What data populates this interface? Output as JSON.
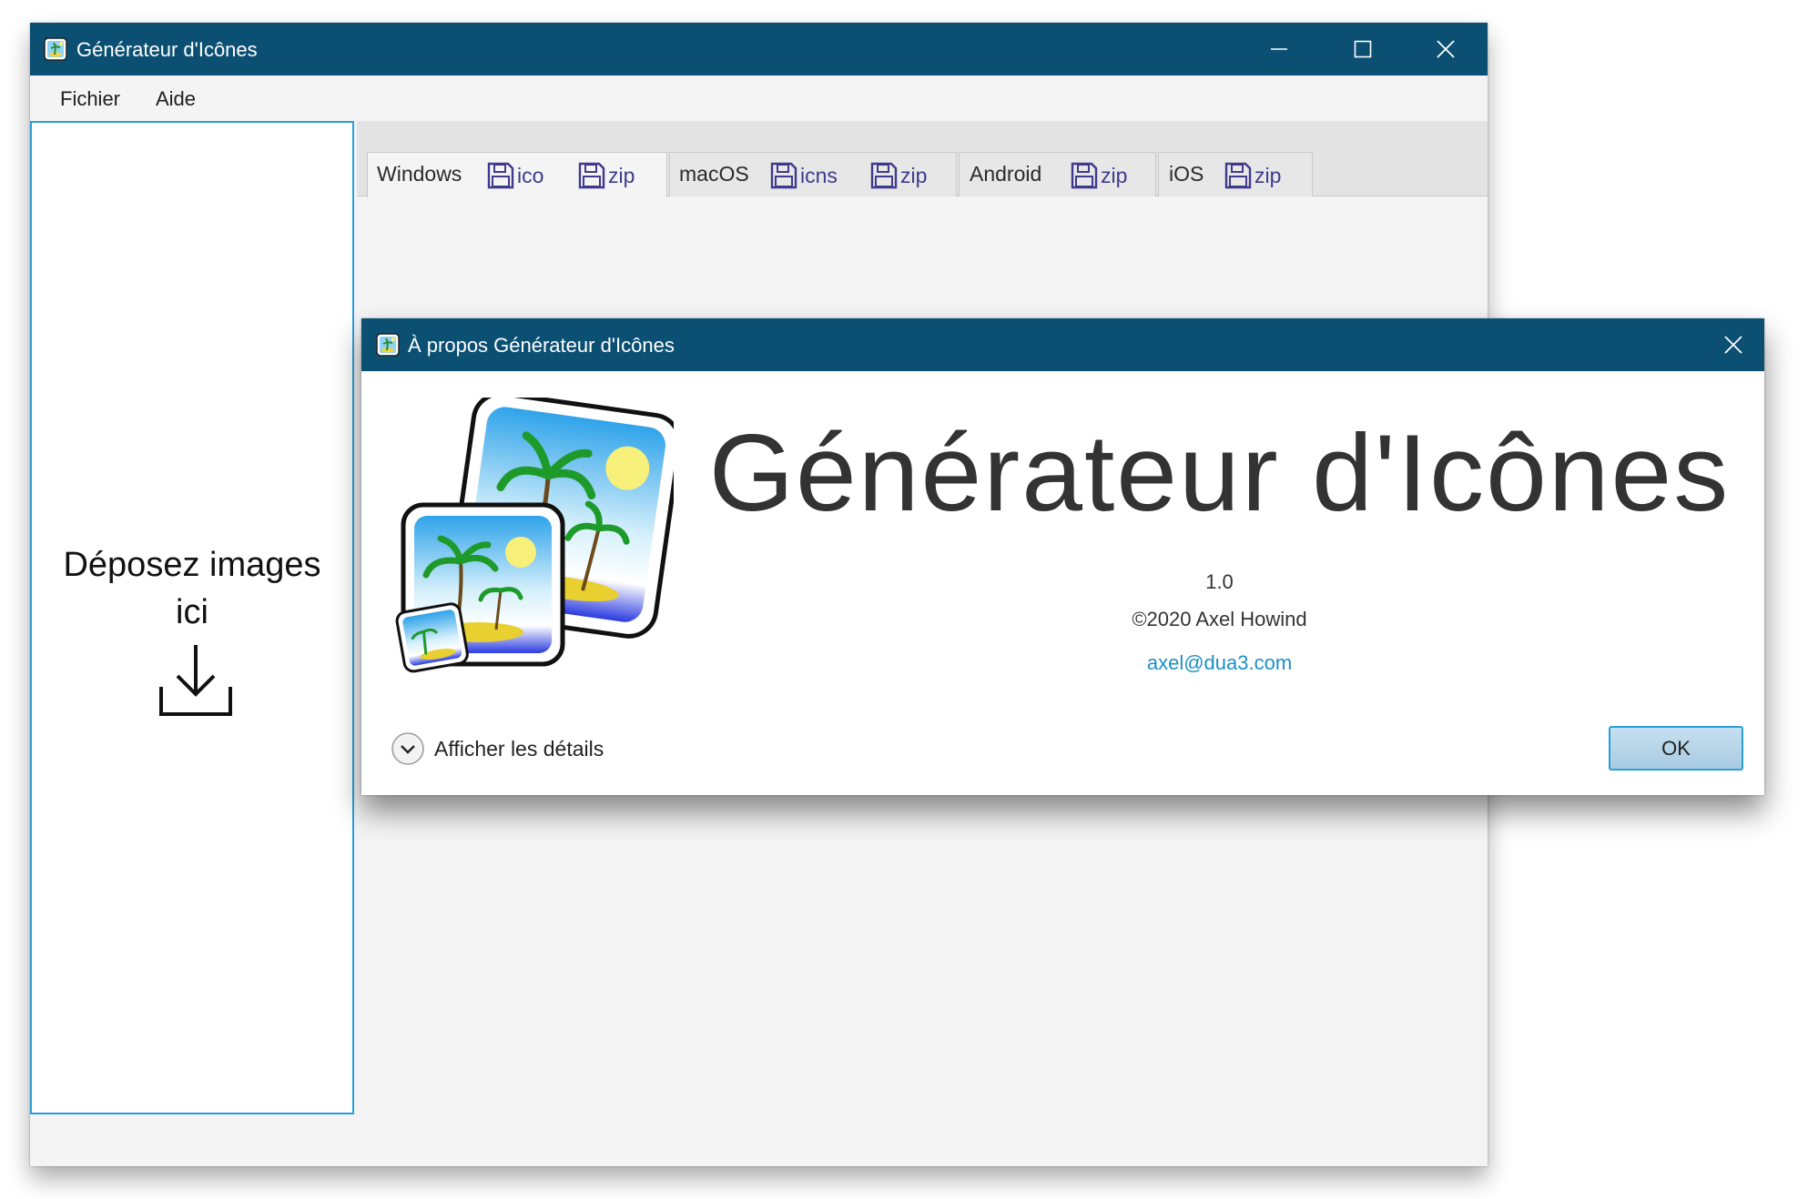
{
  "main_window": {
    "title": "Générateur d'Icônes",
    "controls": {
      "minimize": "minimize-icon",
      "maximize": "maximize-icon",
      "close": "close-icon"
    },
    "menu": [
      "Fichier",
      "Aide"
    ],
    "drop_zone": {
      "line1": "Déposez images",
      "line2": "ici",
      "icon": "download-icon"
    },
    "tabs": [
      {
        "label": "Windows",
        "buttons": [
          "ico",
          "zip"
        ],
        "active": true
      },
      {
        "label": "macOS",
        "buttons": [
          "icns",
          "zip"
        ],
        "active": false
      },
      {
        "label": "Android",
        "buttons": [
          "zip"
        ],
        "active": false
      },
      {
        "label": "iOS",
        "buttons": [
          "zip"
        ],
        "active": false
      }
    ]
  },
  "about_dialog": {
    "title": "À propos Générateur d'Icônes",
    "app_name": "Générateur d'Icônes",
    "version": "1.0",
    "copyright": "©2020 Axel Howind",
    "email": "axel@dua3.com",
    "details_label": "Afficher les détails",
    "ok_label": "OK"
  },
  "colors": {
    "titlebar": "#0b5073",
    "accent_border": "#2a9fd8",
    "link": "#1c8fc6",
    "save_icon": "#3f3a8c"
  }
}
